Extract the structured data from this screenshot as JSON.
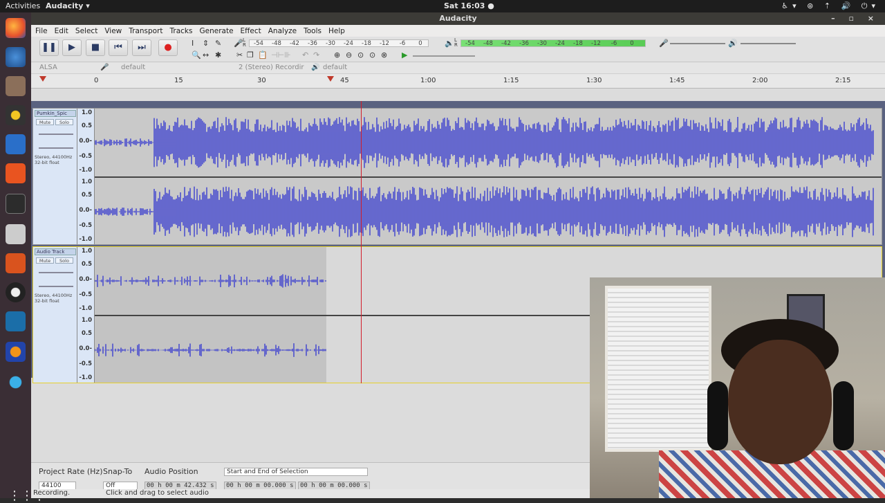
{
  "topbar": {
    "activities": "Activities",
    "app_menu": "Audacity ▾",
    "clock": "Sat 16:03 ●",
    "tray": "♿▾ ⊛ ⇡ 🔊 ⏻▾"
  },
  "window": {
    "title": "Audacity",
    "controls": "– ▫ ×"
  },
  "menu": [
    "File",
    "Edit",
    "Select",
    "View",
    "Transport",
    "Tracks",
    "Generate",
    "Effect",
    "Analyze",
    "Tools",
    "Help"
  ],
  "transport": {
    "pause": "❚❚",
    "play": "▶",
    "stop": "■",
    "skip_start": "⏮",
    "skip_end": "⏭",
    "record": "●"
  },
  "record_meter": [
    "-54",
    "-48",
    "-42",
    "-36",
    "-30",
    "-24",
    "-18",
    "-12",
    "-6",
    "0"
  ],
  "playback_meter": [
    "-54",
    "-48",
    "-42",
    "-36",
    "-30",
    "-24",
    "-18",
    "-12",
    "-6",
    "0"
  ],
  "meter_lr": "L R",
  "device": {
    "host": "ALSA",
    "input": "default",
    "channels": "2 (Stereo) Recordir",
    "output": "default"
  },
  "ruler": {
    "ticks": [
      "0",
      "15",
      "30",
      "45",
      "1:00",
      "1:15",
      "1:30",
      "1:45",
      "2:00",
      "2:15"
    ]
  },
  "tracks": [
    {
      "name": "Pumkin_Spic",
      "mute": "Mute",
      "solo": "Solo",
      "info1": "Stereo, 44100Hz",
      "info2": "32-bit float",
      "scale": [
        "1.0",
        "0.5",
        "0.0-",
        "-0.5",
        "-1.0"
      ]
    },
    {
      "name": "Audio Track",
      "mute": "Mute",
      "solo": "Solo",
      "info1": "Stereo, 44100Hz",
      "info2": "32-bit float",
      "scale": [
        "1.0",
        "0.5",
        "0.0-",
        "-0.5",
        "-1.0"
      ]
    }
  ],
  "selection_toolbar": {
    "rate_label": "Project Rate (Hz)",
    "rate_value": "44100",
    "snap_label": "Snap-To",
    "snap_value": "Off",
    "position_label": "Audio Position",
    "position_value": "00 h 00 m 42.432 s",
    "selection_mode": "Start and End of Selection",
    "sel_start": "00 h 00 m 00.000 s",
    "sel_end": "00 h 00 m 00.000 s"
  },
  "status": {
    "state": "Recording.",
    "hint": "Click and drag to select audio"
  },
  "colors": {
    "waveform": "#3b3fcf",
    "playhead": "#d21c2b",
    "selected_track_border": "#e6d02b"
  }
}
